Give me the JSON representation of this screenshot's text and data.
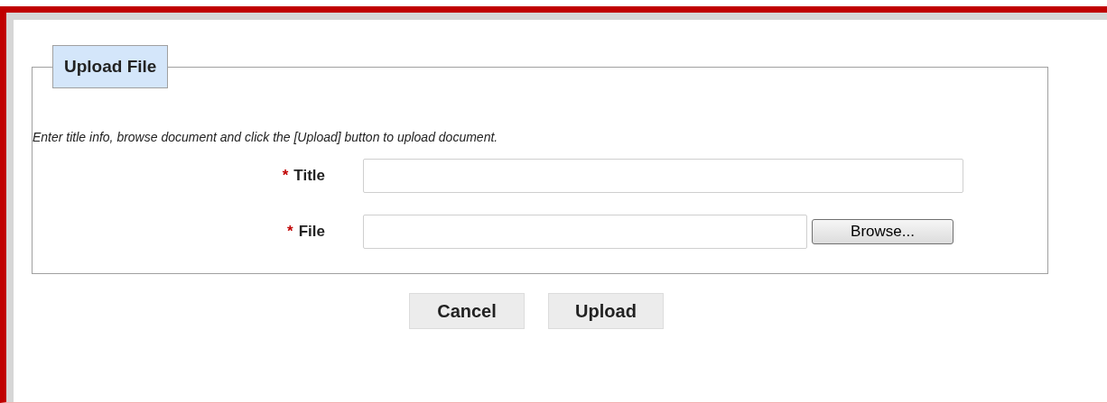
{
  "fieldset": {
    "legend": "Upload File",
    "instructions": "Enter title info, browse document and click the [Upload] button to upload document.",
    "fields": [
      {
        "kind": "text",
        "required_mark": "*",
        "label": "Title"
      },
      {
        "kind": "file",
        "required_mark": "*",
        "label": "File",
        "button": "Browse..."
      }
    ]
  },
  "buttons": [
    "Cancel",
    "Upload"
  ]
}
